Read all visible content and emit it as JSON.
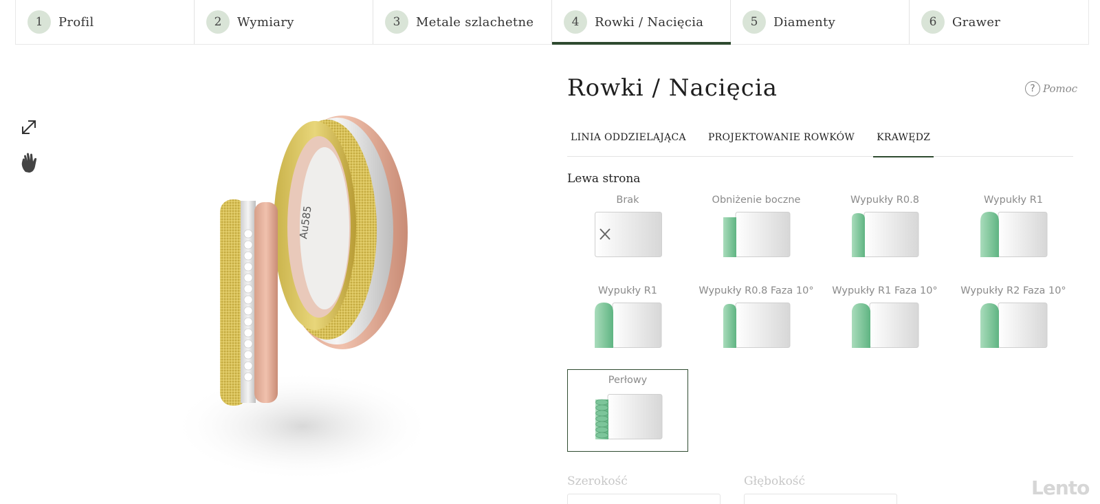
{
  "steps": [
    {
      "num": "1",
      "label": "Profil"
    },
    {
      "num": "2",
      "label": "Wymiary"
    },
    {
      "num": "3",
      "label": "Metale szlachetne"
    },
    {
      "num": "4",
      "label": "Rowki / Nacięcia"
    },
    {
      "num": "5",
      "label": "Diamenty"
    },
    {
      "num": "6",
      "label": "Grawer"
    }
  ],
  "active_step": "4",
  "tools": {
    "expand_icon": "expand-icon",
    "hand_icon": "hand-icon"
  },
  "preview": {
    "ring_engraving": "Au585"
  },
  "panel": {
    "title": "Rowki / Nacięcia",
    "help_label": "Pomoc",
    "tabs": [
      "LINIA ODDZIELAJĄCA",
      "PROJEKTOWANIE ROWKÓW",
      "KRAWĘDZ"
    ],
    "active_tab": "KRAWĘDZ",
    "section_label": "Lewa strona",
    "options": [
      {
        "name": "Brak"
      },
      {
        "name": "Obniżenie boczne"
      },
      {
        "name": "Wypukły R0.8"
      },
      {
        "name": "Wypukły R1"
      },
      {
        "name": "Wypukły R1"
      },
      {
        "name": "Wypukły R0.8 Faza 10°"
      },
      {
        "name": "Wypukły R1 Faza 10°"
      },
      {
        "name": "Wypukły R2 Faza 10°"
      },
      {
        "name": "Perłowy"
      }
    ],
    "selected_option": "Perłowy",
    "width_label": "Szerokość",
    "depth_label": "Głębokość"
  },
  "watermark": "Lento",
  "colors": {
    "accent": "#2e4a2f",
    "step_circle": "#d9e4d7",
    "edge_green": "#8fcfa7"
  }
}
